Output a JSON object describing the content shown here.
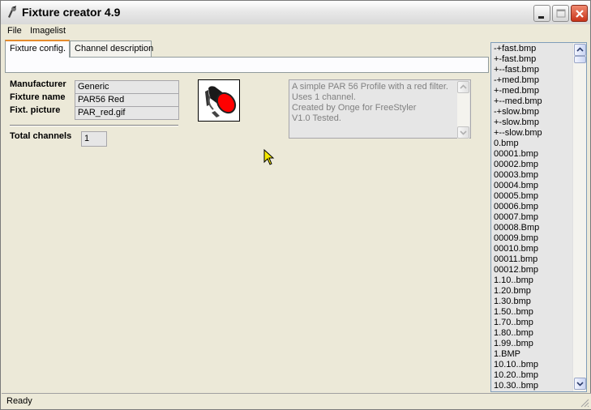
{
  "window": {
    "title": "Fixture creator 4.9"
  },
  "menu": {
    "file": "File",
    "imagelist": "Imagelist"
  },
  "tabs": [
    {
      "label": "Fixture config.",
      "active": true
    },
    {
      "label": "Channel description",
      "active": false
    }
  ],
  "fixture": {
    "manufacturer_label": "Manufacturer",
    "manufacturer": "Generic",
    "name_label": "Fixture name",
    "name": "PAR56 Red",
    "picture_label": "Fixt. picture",
    "picture": "PAR_red.gif",
    "channels_label": "Total channels",
    "channels": "1"
  },
  "description": {
    "text": "A simple PAR 56 Profile with a red filter.\nUses 1 channel.\nCreated by Onge for FreeStyler\nV1.0 Tested."
  },
  "imagelist": {
    "items": [
      "-+fast.bmp",
      "+-fast.bmp",
      "+--fast.bmp",
      "-+med.bmp",
      "+-med.bmp",
      "+--med.bmp",
      "-+slow.bmp",
      "+-slow.bmp",
      "+--slow.bmp",
      "0.bmp",
      "00001.bmp",
      "00002.bmp",
      "00003.bmp",
      "00004.bmp",
      "00005.bmp",
      "00006.bmp",
      "00007.bmp",
      "00008.Bmp",
      "00009.bmp",
      "00010.bmp",
      "00011.bmp",
      "00012.bmp",
      "1.10..bmp",
      "1.20.bmp",
      "1.30.bmp",
      "1.50..bmp",
      "1.70..bmp",
      "1.80..bmp",
      "1.99..bmp",
      "1.BMP",
      "10.10..bmp",
      "10.20..bmp",
      "10.30..bmp"
    ]
  },
  "status": {
    "text": "Ready"
  },
  "colors": {
    "accent_tab": "#e68b2c",
    "close_button": "#c8341a",
    "filter_red": "#ff0000"
  },
  "icons": {
    "app": "fixture-app-icon",
    "picture": "par-can-red-icon",
    "cursor": "mouse-pointer-icon"
  }
}
